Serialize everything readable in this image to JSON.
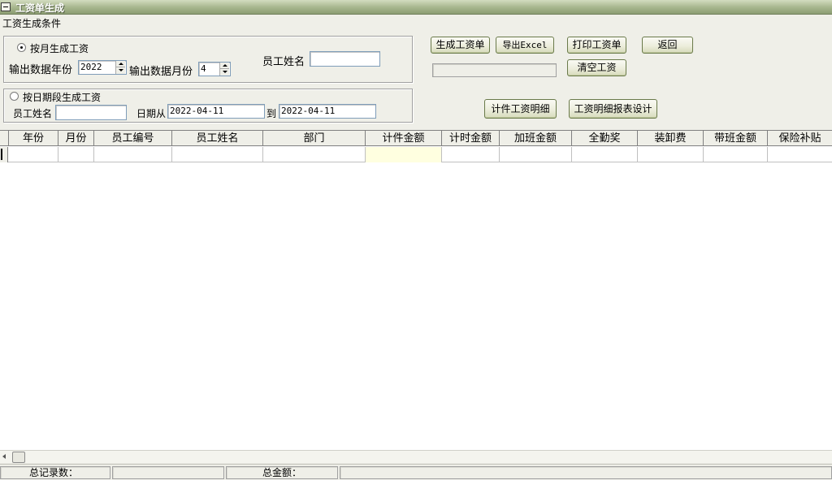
{
  "window": {
    "title": "工资单生成"
  },
  "conditions": {
    "group_label": "工资生成条件",
    "by_month": {
      "radio_label": "按月生成工资",
      "year_label": "输出数据年份",
      "year_value": "2022",
      "month_label": "输出数据月份",
      "month_value": "4",
      "employee_label": "员工姓名",
      "employee_value": ""
    },
    "by_date": {
      "radio_label": "按日期段生成工资",
      "employee_label": "员工姓名",
      "employee_value": "",
      "from_label": "日期从",
      "from_value": "2022-04-11",
      "to_label": "到",
      "to_value": "2022-04-11"
    }
  },
  "actions": {
    "generate": "生成工资单",
    "export_excel": "导出Excel",
    "print": "打印工资单",
    "back": "返回",
    "clear": "清空工资",
    "piece_detail": "计件工资明细",
    "detail_report_design": "工资明细报表设计"
  },
  "grid": {
    "columns": [
      "年份",
      "月份",
      "员工编号",
      "员工姓名",
      "部门",
      "计件金额",
      "计时金额",
      "加班金额",
      "全勤奖",
      "装卸费",
      "带班金额",
      "保险补贴"
    ]
  },
  "status": {
    "total_records_label": "总记录数：",
    "total_records_value": "",
    "total_amount_label": "总金额：",
    "total_amount_value": ""
  }
}
